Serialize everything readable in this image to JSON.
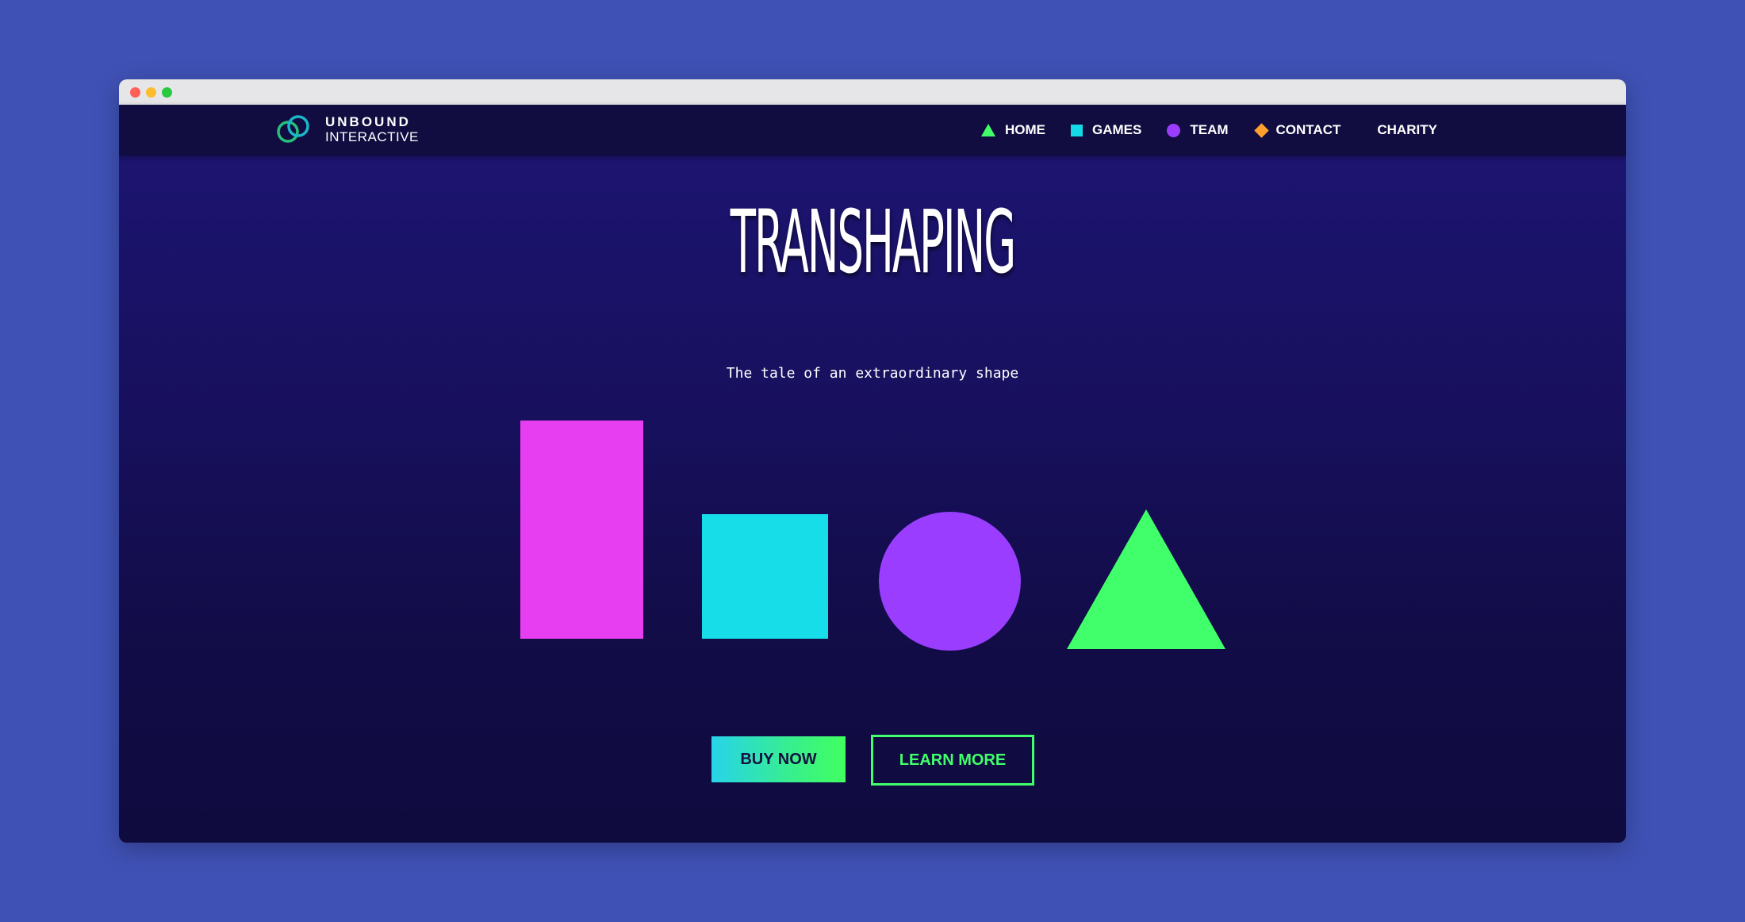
{
  "brand": {
    "line1": "UNBOUND",
    "line2": "INTERACTIVE",
    "accent_color": "#41ff6b",
    "logo_icon": "interlocking-rings-icon"
  },
  "nav": {
    "items": [
      {
        "label": "HOME",
        "icon": "triangle-icon",
        "color": "#41ff6b"
      },
      {
        "label": "GAMES",
        "icon": "square-icon",
        "color": "#16d9e7"
      },
      {
        "label": "TEAM",
        "icon": "circle-icon",
        "color": "#9a3dff"
      },
      {
        "label": "CONTACT",
        "icon": "diamond-icon",
        "color": "#ff9f2e"
      },
      {
        "label": "CHARITY"
      }
    ]
  },
  "hero": {
    "title": "TRANSHAPING",
    "subtitle": "The tale of an extraordinary shape",
    "shapes": [
      {
        "name": "rectangle",
        "color": "#e83ef1"
      },
      {
        "name": "square",
        "color": "#16dde8"
      },
      {
        "name": "circle",
        "color": "#9a3dff"
      },
      {
        "name": "triangle",
        "color": "#41ff6b"
      }
    ],
    "buy_label": "BUY NOW",
    "learn_label": "LEARN MORE"
  },
  "social": {
    "icons": [
      "twitter-icon",
      "discord-icon",
      "twitch-icon"
    ],
    "color": "#16d9e7"
  },
  "page": {
    "background": "#3f51b5",
    "hero_background": "#1c1470"
  }
}
